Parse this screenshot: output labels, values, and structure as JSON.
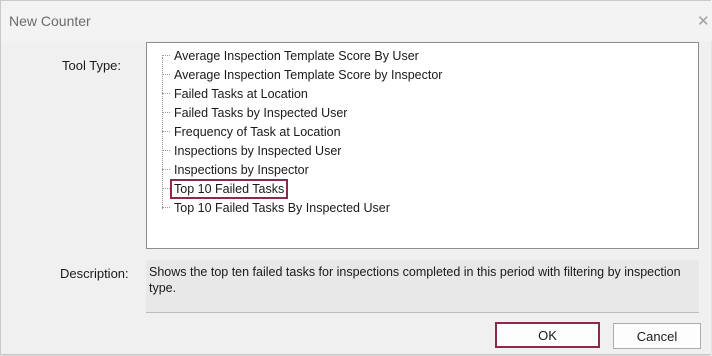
{
  "dialog": {
    "title": "New Counter",
    "close_glyph": "✕"
  },
  "tool_type": {
    "label": "Tool Type:",
    "items": [
      "Average Inspection Template Score By User",
      "Average Inspection Template Score by Inspector",
      "Failed Tasks at Location",
      "Failed Tasks by Inspected User",
      "Frequency of Task at Location",
      "Inspections by Inspected User",
      "Inspections by Inspector",
      "Top 10 Failed Tasks",
      "Top 10 Failed Tasks By Inspected User"
    ],
    "selected": "Top 10 Failed Tasks"
  },
  "description": {
    "label": "Description:",
    "text": "Shows the top ten failed tasks for inspections completed in this period with filtering by inspection type."
  },
  "buttons": {
    "ok": "OK",
    "cancel": "Cancel"
  },
  "colors": {
    "highlight": "#8a2a4e",
    "dialog_bg": "#f0f0f0"
  }
}
